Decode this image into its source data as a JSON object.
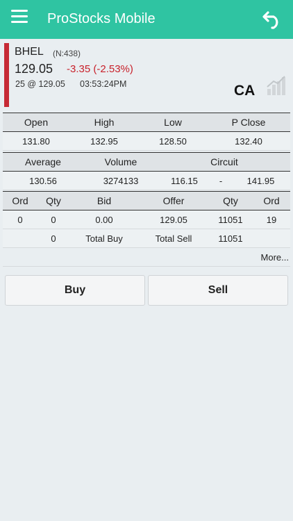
{
  "header": {
    "title": "ProStocks Mobile",
    "menu_icon": "hamburger-menu-icon",
    "back_icon": "undo-arrow-icon"
  },
  "quote": {
    "symbol": "BHEL",
    "token": "(N:438)",
    "ltp": "129.05",
    "change": "-3.35 (-2.53%)",
    "last_trade": "25 @ 129.05",
    "last_time": "03:53:24PM",
    "ca_label": "CA",
    "chart_icon": "bar-chart-icon",
    "change_color": "#c8202a",
    "accent_bar_color": "#c62a35"
  },
  "ohlc": {
    "headers": [
      "Open",
      "High",
      "Low",
      "P Close"
    ],
    "values": [
      "131.80",
      "132.95",
      "128.50",
      "132.40"
    ]
  },
  "stats": {
    "headers": [
      "Average",
      "Volume",
      "Circuit"
    ],
    "average": "130.56",
    "volume": "3274133",
    "circuit_low": "116.15",
    "circuit_sep": "-",
    "circuit_high": "141.95"
  },
  "depth": {
    "headers": [
      "Ord",
      "Qty",
      "Bid",
      "Offer",
      "Qty",
      "Ord"
    ],
    "row": [
      "0",
      "0",
      "0.00",
      "129.05",
      "11051",
      "19"
    ],
    "totals": {
      "buy_qty": "0",
      "buy_label": "Total Buy",
      "sell_label": "Total Sell",
      "sell_qty": "11051"
    }
  },
  "more_label": "More...",
  "actions": {
    "buy_label": "Buy",
    "sell_label": "Sell"
  },
  "colors": {
    "topbar": "#2fc4a2",
    "background": "#e9eef1"
  }
}
